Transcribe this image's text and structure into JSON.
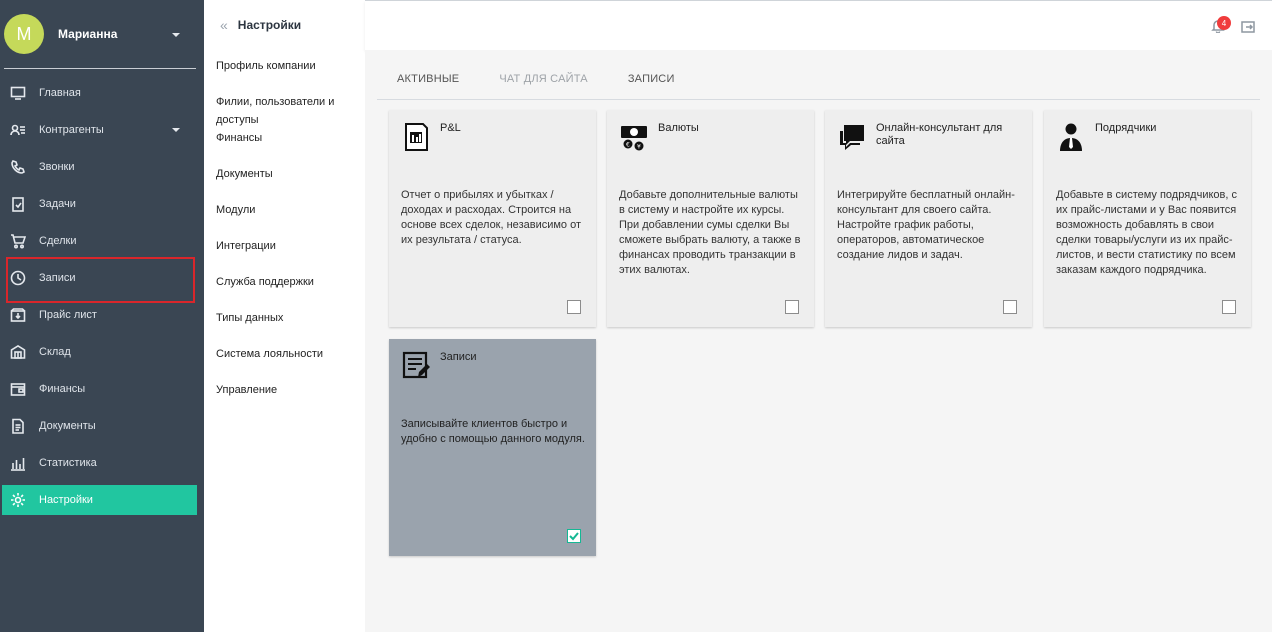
{
  "user": {
    "initial": "M",
    "name": "Марианна"
  },
  "nav": [
    {
      "label": "Главная",
      "icon": "monitor-icon"
    },
    {
      "label": "Контрагенты",
      "icon": "contacts-icon",
      "has_caret": true
    },
    {
      "label": "Звонки",
      "icon": "phone-icon"
    },
    {
      "label": "Задачи",
      "icon": "task-icon"
    },
    {
      "label": "Сделки",
      "icon": "cart-icon"
    },
    {
      "label": "Записи",
      "icon": "clock-icon"
    },
    {
      "label": "Прайс лист",
      "icon": "price-icon"
    },
    {
      "label": "Склад",
      "icon": "warehouse-icon"
    },
    {
      "label": "Финансы",
      "icon": "finance-icon"
    },
    {
      "label": "Документы",
      "icon": "documents-icon"
    },
    {
      "label": "Статистика",
      "icon": "stats-icon"
    },
    {
      "label": "Настройки",
      "icon": "gear-icon",
      "active": true
    }
  ],
  "settings": {
    "title": "Настройки",
    "back_label": "«",
    "items": [
      "Профиль компании",
      "Филии, пользователи и доступы",
      "Финансы",
      "Документы",
      "Модули",
      "Интеграции",
      "Служба поддержки",
      "Типы данных",
      "Система лояльности",
      "Управление"
    ]
  },
  "topbar": {
    "notifications_count": "4"
  },
  "tabs": [
    {
      "label": "Активные",
      "muted": false
    },
    {
      "label": "Чат для сайта",
      "muted": true
    },
    {
      "label": "Записи",
      "muted": false
    }
  ],
  "modules": [
    {
      "title": "P&L",
      "icon": "report-icon",
      "description": "Отчет о прибылях и убытках / доходах и расходах. Строится на основе всех сделок, независимо от их результата / статуса.",
      "checked": false
    },
    {
      "title": "Валюты",
      "icon": "currency-icon",
      "description": "Добавьте дополнительные валюты в систему и настройте их курсы. При добавлении сумы сделки Вы сможете выбрать валюту, а также в финансах проводить транзакции в этих валютах.",
      "checked": false
    },
    {
      "title": "Онлайн-консультант для сайта",
      "icon": "chat-icon",
      "description": "Интегрируйте бесплатный онлайн-консультант для своего сайта. Настройте график работы, операторов, автоматическое создание лидов и задач.",
      "checked": false
    },
    {
      "title": "Подрядчики",
      "icon": "contractor-icon",
      "description": "Добавьте в систему подрядчиков, с их прайс-листами и у Вас появится возможность добавлять в свои сделки товары/услуги из их прайс-листов, и вести статистику по всем заказам каждого подрядчика.",
      "checked": false
    },
    {
      "title": "Записи",
      "icon": "records-icon",
      "description": "Записывайте клиентов быстро и удобно с помощью данного модуля.",
      "checked": true
    }
  ]
}
